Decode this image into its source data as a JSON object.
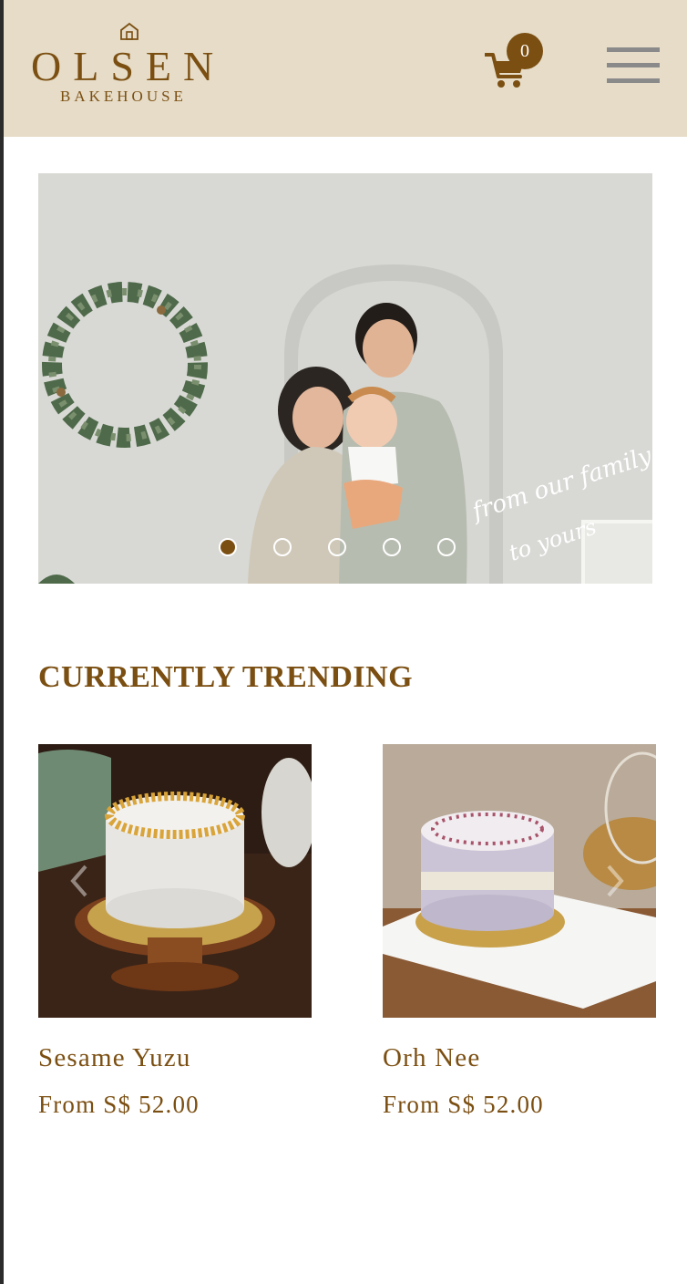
{
  "brand": {
    "name": "OLSEN",
    "tagline": "BAKEHOUSE",
    "accent_color": "#7b4f12",
    "header_bg": "#e6dcc7"
  },
  "header": {
    "cart_icon": "shopping-cart-icon",
    "cart_count": "0",
    "menu_icon": "hamburger-menu-icon"
  },
  "hero": {
    "script_text_line1": "from our family",
    "script_text_line2": "to yours",
    "slide_count": 5,
    "active_slide": 1
  },
  "trending": {
    "title": "CURRENTLY TRENDING",
    "products": [
      {
        "name": "Sesame Yuzu",
        "price": "From S$ 52.00"
      },
      {
        "name": "Orh Nee",
        "price": "From S$ 52.00"
      }
    ]
  }
}
